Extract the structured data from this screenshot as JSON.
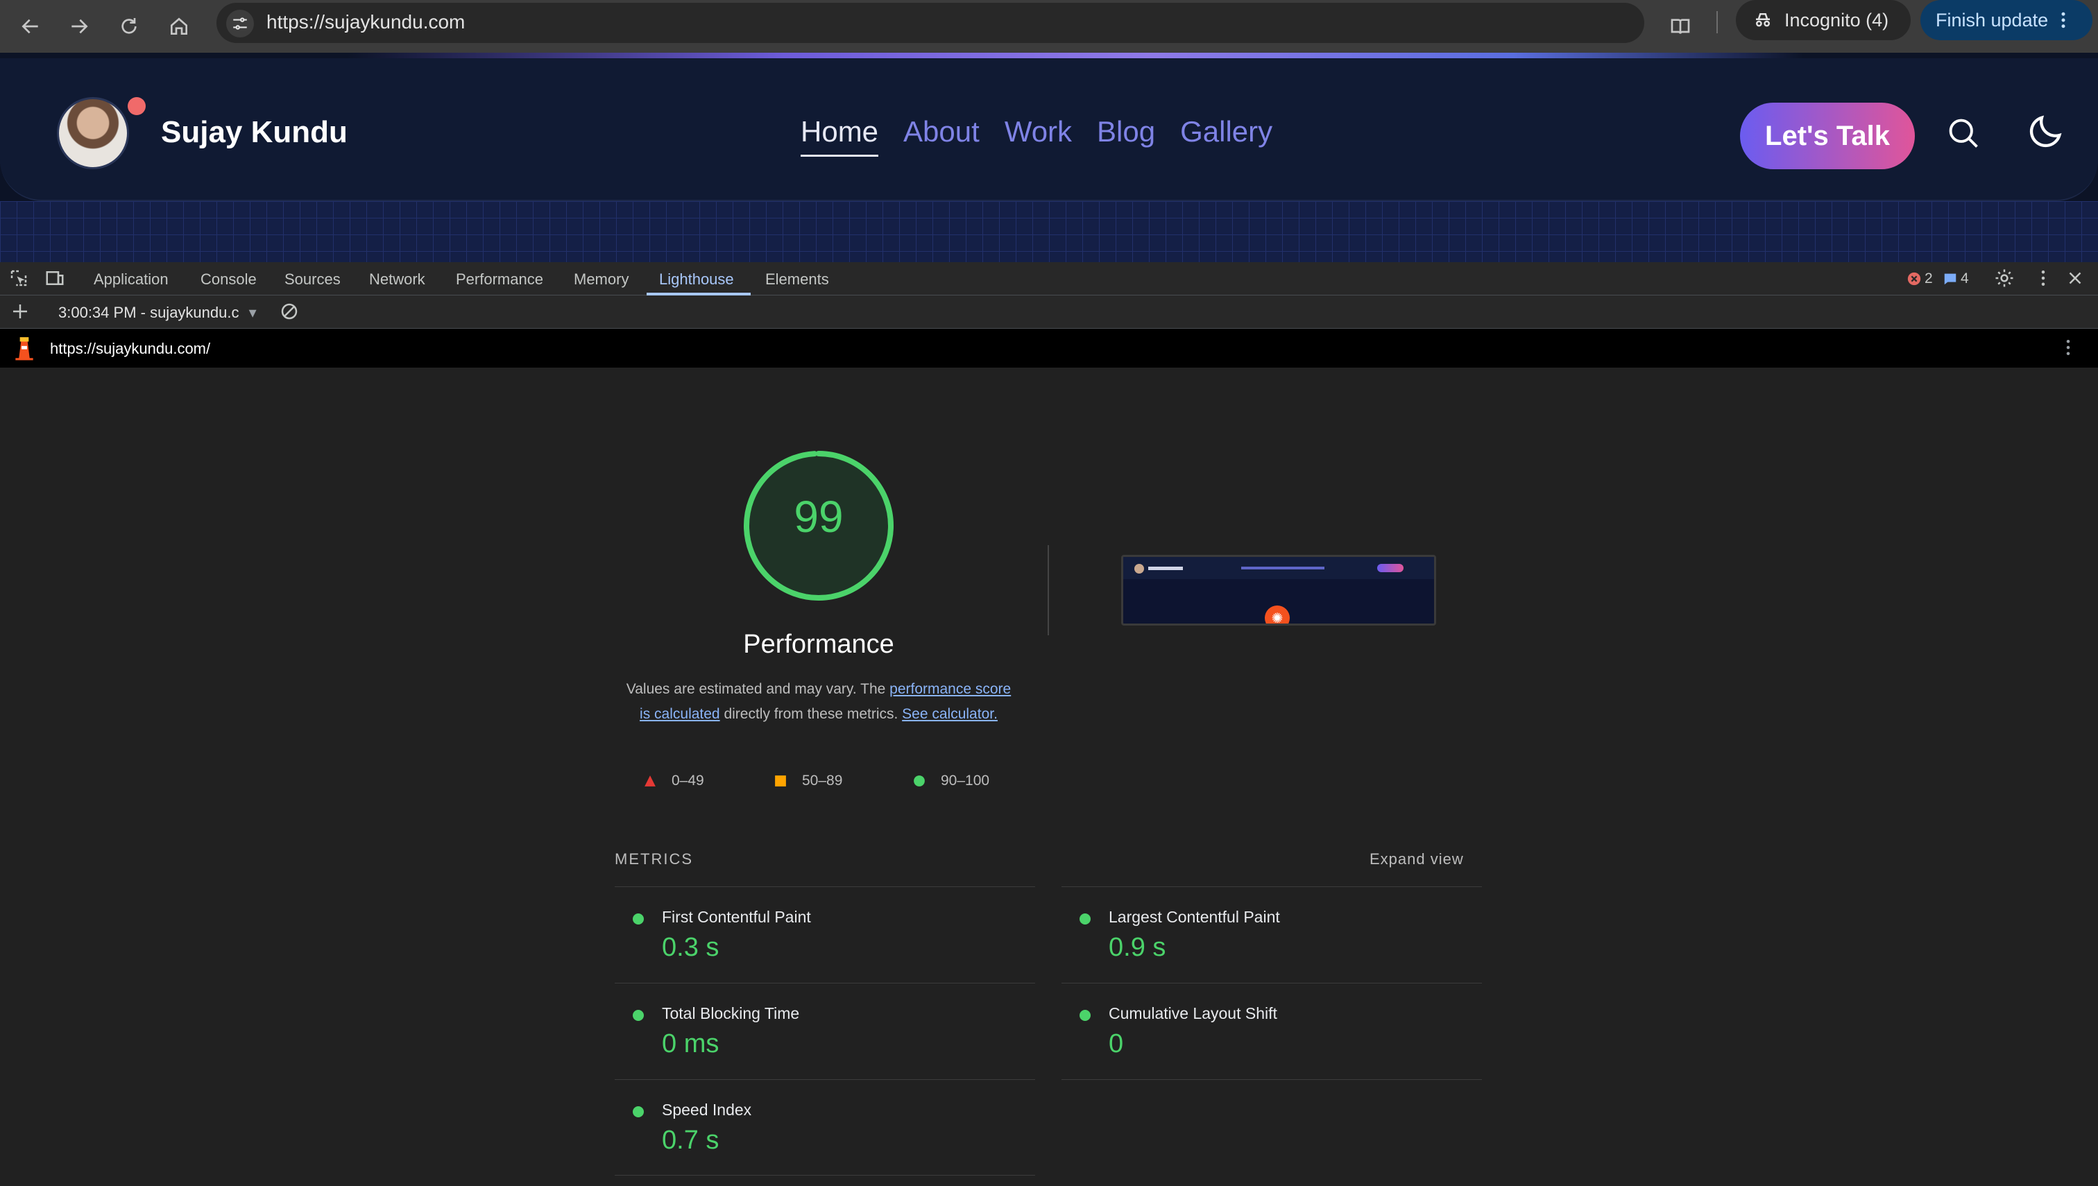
{
  "browser": {
    "url": "https://sujaykundu.com",
    "incognito_label": "Incognito (4)",
    "finish_update_label": "Finish update"
  },
  "site": {
    "name": "Sujay Kundu",
    "nav": [
      {
        "label": "Home",
        "active": true
      },
      {
        "label": "About"
      },
      {
        "label": "Work"
      },
      {
        "label": "Blog"
      },
      {
        "label": "Gallery"
      }
    ],
    "cta_label": "Let's Talk"
  },
  "devtools": {
    "tabs": [
      "Application",
      "Console",
      "Sources",
      "Network",
      "Performance",
      "Memory",
      "Lighthouse",
      "Elements"
    ],
    "active_tab": "Lighthouse",
    "error_count": "2",
    "message_count": "4",
    "report_selector": "3:00:34 PM - sujaykundu.c",
    "report_url": "https://sujaykundu.com/"
  },
  "report": {
    "score": "99",
    "score_fraction": 0.99,
    "category": "Performance",
    "desc_prefix": "Values are estimated and may vary. The ",
    "desc_link1": "performance score is calculated",
    "desc_middle": " directly from these metrics. ",
    "desc_link2": "See calculator.",
    "legend": [
      {
        "range": "0–49",
        "shape": "triangle",
        "color": "#e53935"
      },
      {
        "range": "50–89",
        "shape": "square",
        "color": "#ffa400"
      },
      {
        "range": "90–100",
        "shape": "circle",
        "color": "#4bd36a"
      }
    ],
    "metrics_label": "METRICS",
    "expand_label": "Expand view",
    "metrics": [
      {
        "name": "First Contentful Paint",
        "value": "0.3 s"
      },
      {
        "name": "Largest Contentful Paint",
        "value": "0.9 s"
      },
      {
        "name": "Total Blocking Time",
        "value": "0 ms"
      },
      {
        "name": "Cumulative Layout Shift",
        "value": "0"
      },
      {
        "name": "Speed Index",
        "value": "0.7 s"
      }
    ],
    "colors": {
      "pass": "#4bd36a",
      "link": "#8ab4f8"
    }
  }
}
